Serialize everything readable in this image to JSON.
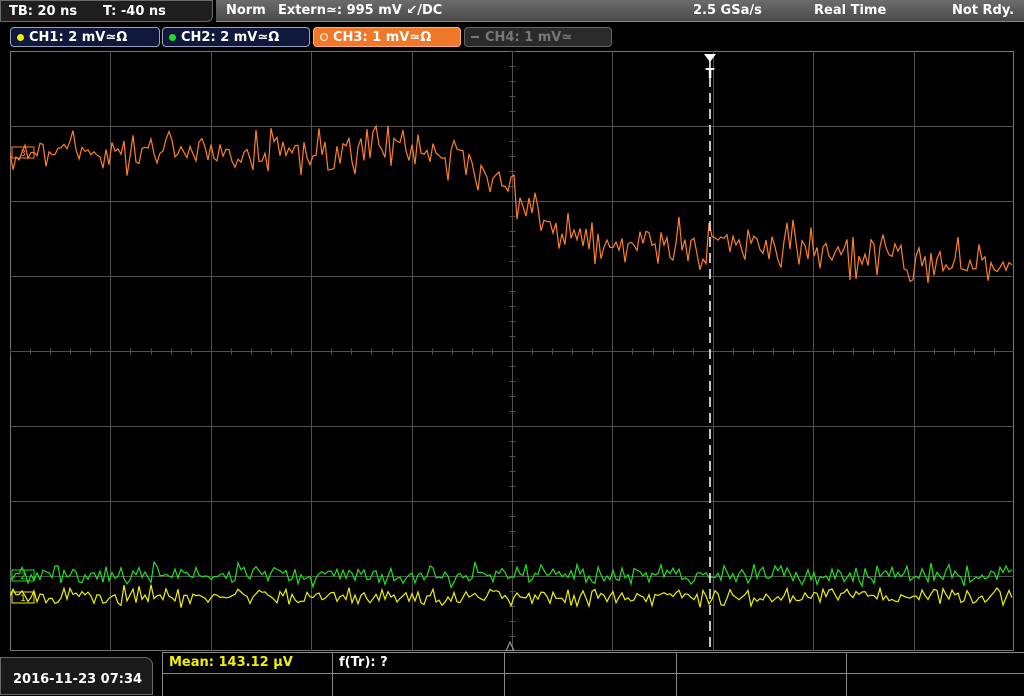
{
  "timebase": {
    "tb": "TB: 20 ns",
    "t": "T: -40 ns"
  },
  "status": {
    "mode": "Norm",
    "trigger": "Extern≃: 995 mV ↙/DC",
    "sample_rate": "2.5 GSa/s",
    "acq": "Real Time",
    "state": "Not Rdy."
  },
  "channels": [
    {
      "label": "CH1: 2 mV≃Ω",
      "color": "#f0f000",
      "active": true
    },
    {
      "label": "CH2: 2 mV≃Ω",
      "color": "#20e020",
      "active": true
    },
    {
      "label": "CH3: 1 mV≃Ω",
      "color": "#ff7f27",
      "active": true,
      "selected": true
    },
    {
      "label": "CH4: 1 mV≃",
      "color": "#777777",
      "active": false
    }
  ],
  "markers": {
    "trigger": "T",
    "ch1": "1",
    "ch2": "2",
    "ch3": "3"
  },
  "footer": {
    "datetime": "2016-11-23 07:34",
    "mean": "Mean: 143.12 µV",
    "ftr": "f(Tr): ?"
  },
  "colors": {
    "ch1": "#f0f000",
    "ch2": "#20e020",
    "ch3": "#ff7f27",
    "grid": "#505050"
  }
}
